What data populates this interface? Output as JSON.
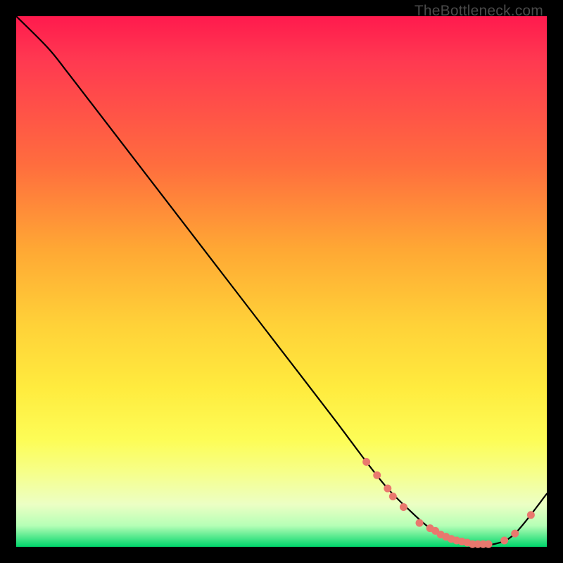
{
  "watermark": "TheBottleneck.com",
  "chart_data": {
    "type": "line",
    "title": "",
    "xlabel": "",
    "ylabel": "",
    "xlim": [
      0,
      100
    ],
    "ylim": [
      0,
      100
    ],
    "series": [
      {
        "name": "bottleneck-curve",
        "x": [
          0,
          6,
          10,
          20,
          30,
          40,
          50,
          60,
          66,
          70,
          74,
          78,
          82,
          86,
          90,
          94,
          100
        ],
        "y": [
          100,
          94,
          89,
          76,
          63,
          50,
          37,
          24,
          16,
          11,
          7,
          3.5,
          1.5,
          0.5,
          0.5,
          2.5,
          10
        ]
      }
    ],
    "markers": {
      "name": "highlight-dots",
      "color": "#e9786e",
      "x": [
        66,
        68,
        70,
        71,
        73,
        76,
        78,
        79,
        80,
        81,
        82,
        83,
        84,
        85,
        86,
        87,
        88,
        89,
        92,
        94,
        97
      ],
      "y": [
        16,
        13.5,
        11,
        9.5,
        7.5,
        4.5,
        3.5,
        3,
        2.3,
        1.9,
        1.5,
        1.2,
        1,
        0.8,
        0.5,
        0.5,
        0.5,
        0.5,
        1.2,
        2.5,
        6
      ]
    }
  }
}
